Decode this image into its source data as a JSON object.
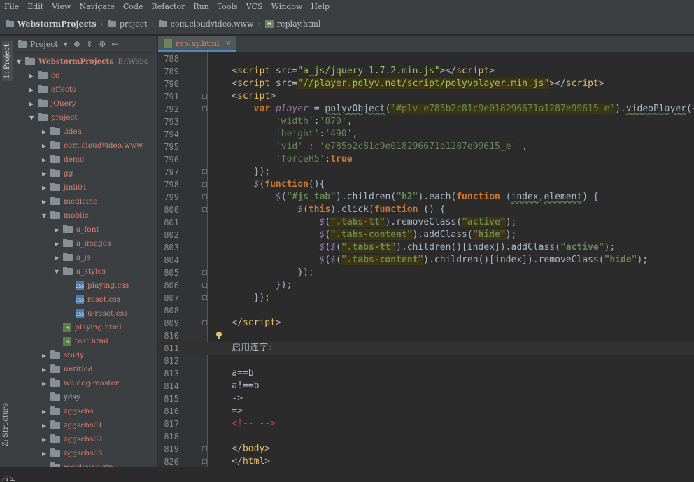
{
  "menu": [
    "File",
    "Edit",
    "View",
    "Navigate",
    "Code",
    "Refactor",
    "Run",
    "Tools",
    "VCS",
    "Window",
    "Help"
  ],
  "breadcrumb": [
    "WebstormProjects",
    "project",
    "com.cloudvideo.www",
    "replay.html"
  ],
  "side_tabs": {
    "project": "1: Project",
    "structure": "Z: Structure",
    "favorites": "2: F"
  },
  "project_panel": {
    "dropdown_label": "Project",
    "root": {
      "name": "WebstormProjects",
      "path": "E:\\Webs"
    },
    "items": [
      {
        "label": "cc",
        "type": "folder",
        "depth": 1,
        "expanded": false
      },
      {
        "label": "effects",
        "type": "folder",
        "depth": 1,
        "expanded": false
      },
      {
        "label": "jQuery",
        "type": "folder",
        "depth": 1,
        "expanded": false
      },
      {
        "label": "project",
        "type": "folder",
        "depth": 1,
        "expanded": true
      },
      {
        "label": ".idea",
        "type": "folder",
        "depth": 2,
        "expanded": false
      },
      {
        "label": "com.cloudvideo.www",
        "type": "folder",
        "depth": 2,
        "expanded": false
      },
      {
        "label": "demo",
        "type": "folder",
        "depth": 2,
        "expanded": false
      },
      {
        "label": "gg",
        "type": "folder",
        "depth": 2,
        "expanded": false
      },
      {
        "label": "jinli01",
        "type": "folder",
        "depth": 2,
        "expanded": false
      },
      {
        "label": "medicine",
        "type": "folder",
        "depth": 2,
        "expanded": false
      },
      {
        "label": "mobile",
        "type": "folder",
        "depth": 2,
        "expanded": true
      },
      {
        "label": "a_font",
        "type": "folder",
        "depth": 3,
        "expanded": false
      },
      {
        "label": "a_images",
        "type": "folder",
        "depth": 3,
        "expanded": false
      },
      {
        "label": "a_js",
        "type": "folder",
        "depth": 3,
        "expanded": false
      },
      {
        "label": "a_styles",
        "type": "folder",
        "depth": 3,
        "expanded": true
      },
      {
        "label": "playing.css",
        "type": "css",
        "depth": 4
      },
      {
        "label": "reset.css",
        "type": "css",
        "depth": 4
      },
      {
        "label": "u-reset.css",
        "type": "css",
        "depth": 4
      },
      {
        "label": "playing.html",
        "type": "html",
        "depth": 3
      },
      {
        "label": "test.html",
        "type": "html",
        "depth": 3
      },
      {
        "label": "study",
        "type": "folder",
        "depth": 2,
        "expanded": false
      },
      {
        "label": "untitled",
        "type": "folder",
        "depth": 2,
        "expanded": false
      },
      {
        "label": "we.dog-master",
        "type": "folder",
        "depth": 2,
        "expanded": false
      },
      {
        "label": "ydsy",
        "type": "folder",
        "depth": 2,
        "expanded": null
      },
      {
        "label": "zggscbs",
        "type": "folder",
        "depth": 2,
        "expanded": false
      },
      {
        "label": "zggscbs01",
        "type": "folder",
        "depth": 2,
        "expanded": false
      },
      {
        "label": "zggscbs02",
        "type": "folder",
        "depth": 2,
        "expanded": false
      },
      {
        "label": "zggscbs03",
        "type": "folder",
        "depth": 2,
        "expanded": false
      },
      {
        "label": "meidicine.zip",
        "type": "file",
        "depth": 2
      }
    ]
  },
  "editor": {
    "tab": "replay.html",
    "lines": [
      {
        "n": "788",
        "segs": []
      },
      {
        "n": "789",
        "segs": [
          [
            "a",
            "    <"
          ],
          [
            "t",
            "script "
          ],
          [
            "a",
            "src="
          ],
          [
            "s",
            "\"a_js/jquery-1.7.2.min.js\""
          ],
          [
            "a",
            ">"
          ],
          [
            "a",
            "</"
          ],
          [
            "t",
            "script"
          ],
          [
            "a",
            ">"
          ]
        ]
      },
      {
        "n": "790",
        "segs": [
          [
            "a",
            "    <"
          ],
          [
            "t",
            "script "
          ],
          [
            "a",
            "src="
          ],
          [
            "s",
            "\"//player.polyv.net/script/polyvplayer.min.js\""
          ],
          [
            "a",
            ">"
          ],
          [
            "a",
            "</"
          ],
          [
            "t",
            "script"
          ],
          [
            "a",
            ">"
          ]
        ]
      },
      {
        "n": "791",
        "segs": [
          [
            "a",
            "    <"
          ],
          [
            "t",
            "script"
          ],
          [
            "a",
            ">"
          ]
        ]
      },
      {
        "n": "792",
        "segs": [
          [
            "v",
            "        "
          ],
          [
            "k",
            "var "
          ],
          [
            "sq",
            "player"
          ],
          [
            "v",
            " = "
          ],
          [
            "u",
            "polyvObject"
          ],
          [
            "v",
            "("
          ],
          [
            "str",
            "'#plv_e785b2c81c9e018296671a1287e99615_e'"
          ],
          [
            "v",
            ")."
          ],
          [
            "u",
            "videoPlayer"
          ],
          [
            "v",
            "({"
          ]
        ]
      },
      {
        "n": "793",
        "segs": [
          [
            "v",
            "            "
          ],
          [
            "str",
            "'width'"
          ],
          [
            "v",
            ":"
          ],
          [
            "str",
            "'870'"
          ],
          [
            "v",
            ","
          ]
        ]
      },
      {
        "n": "794",
        "segs": [
          [
            "v",
            "            "
          ],
          [
            "str",
            "'height'"
          ],
          [
            "v",
            ":"
          ],
          [
            "str",
            "'490'"
          ],
          [
            "v",
            ","
          ]
        ]
      },
      {
        "n": "795",
        "segs": [
          [
            "v",
            "            "
          ],
          [
            "str",
            "'vid'"
          ],
          [
            "v",
            " : "
          ],
          [
            "str",
            "'e785b2c81c9e018296671a1287e99615_e'"
          ],
          [
            "v",
            " ,"
          ]
        ]
      },
      {
        "n": "796",
        "segs": [
          [
            "v",
            "            "
          ],
          [
            "str",
            "'forceH5'"
          ],
          [
            "v",
            ":"
          ],
          [
            "k",
            "true"
          ]
        ]
      },
      {
        "n": "797",
        "segs": [
          [
            "v",
            "        });"
          ]
        ]
      },
      {
        "n": "798",
        "segs": [
          [
            "v",
            "        "
          ],
          [
            "sq",
            "$"
          ],
          [
            "v",
            "("
          ],
          [
            "k",
            "function"
          ],
          [
            "v",
            "(){"
          ]
        ]
      },
      {
        "n": "799",
        "segs": [
          [
            "v",
            "            "
          ],
          [
            "sq",
            "$"
          ],
          [
            "v",
            "("
          ],
          [
            "sb",
            "\"#js_tab\""
          ],
          [
            "v",
            ").children("
          ],
          [
            "sb",
            "\"h2\""
          ],
          [
            "v",
            ").each("
          ],
          [
            "k",
            "function "
          ],
          [
            "v",
            "("
          ],
          [
            "u",
            "index"
          ],
          [
            "v",
            ","
          ],
          [
            "u",
            "element"
          ],
          [
            "v",
            ") {"
          ]
        ]
      },
      {
        "n": "800",
        "segs": [
          [
            "v",
            "                "
          ],
          [
            "sq",
            "$"
          ],
          [
            "v",
            "("
          ],
          [
            "k",
            "this"
          ],
          [
            "v",
            ").click("
          ],
          [
            "k",
            "function "
          ],
          [
            "v",
            "() {"
          ]
        ]
      },
      {
        "n": "801",
        "segs": [
          [
            "v",
            "                    "
          ],
          [
            "sq",
            "$"
          ],
          [
            "v",
            "("
          ],
          [
            "sb",
            "\".tabs-tt\""
          ],
          [
            "v",
            ").removeClass("
          ],
          [
            "sb",
            "\"active\""
          ],
          [
            "v",
            ");"
          ]
        ]
      },
      {
        "n": "802",
        "segs": [
          [
            "v",
            "                    "
          ],
          [
            "sq",
            "$"
          ],
          [
            "v",
            "("
          ],
          [
            "sb",
            "\".tabs-content\""
          ],
          [
            "v",
            ").addClass("
          ],
          [
            "sb",
            "\"hide\""
          ],
          [
            "v",
            ");"
          ]
        ]
      },
      {
        "n": "803",
        "segs": [
          [
            "v",
            "                    "
          ],
          [
            "sq",
            "$"
          ],
          [
            "v",
            "("
          ],
          [
            "sq",
            "$"
          ],
          [
            "v",
            "("
          ],
          [
            "sb",
            "\".tabs-tt\""
          ],
          [
            "v",
            ").children()[index]).addClass("
          ],
          [
            "sb",
            "\"active\""
          ],
          [
            "v",
            ");"
          ]
        ]
      },
      {
        "n": "804",
        "segs": [
          [
            "v",
            "                    "
          ],
          [
            "sq",
            "$"
          ],
          [
            "v",
            "("
          ],
          [
            "sq",
            "$"
          ],
          [
            "v",
            "("
          ],
          [
            "sb",
            "\".tabs-content\""
          ],
          [
            "v",
            ").children()[index]).removeClass("
          ],
          [
            "sb",
            "\"hide\""
          ],
          [
            "v",
            ");"
          ]
        ]
      },
      {
        "n": "805",
        "segs": [
          [
            "v",
            "                });"
          ]
        ]
      },
      {
        "n": "806",
        "segs": [
          [
            "v",
            "            });"
          ]
        ]
      },
      {
        "n": "807",
        "segs": [
          [
            "v",
            "        });"
          ]
        ]
      },
      {
        "n": "808",
        "segs": []
      },
      {
        "n": "809",
        "segs": [
          [
            "a",
            "    </"
          ],
          [
            "t",
            "script"
          ],
          [
            "a",
            ">"
          ]
        ]
      },
      {
        "n": "810",
        "segs": []
      },
      {
        "n": "811",
        "segs": [
          [
            "v",
            "    启用连字:"
          ]
        ]
      },
      {
        "n": "812",
        "segs": []
      },
      {
        "n": "813",
        "segs": [
          [
            "v",
            "    a==b"
          ]
        ]
      },
      {
        "n": "814",
        "segs": [
          [
            "v",
            "    a!==b"
          ]
        ]
      },
      {
        "n": "815",
        "segs": [
          [
            "v",
            "    ->"
          ]
        ]
      },
      {
        "n": "816",
        "segs": [
          [
            "v",
            "    =>"
          ]
        ]
      },
      {
        "n": "817",
        "segs": [
          [
            "red",
            "    <!-- -->"
          ]
        ]
      },
      {
        "n": "818",
        "segs": []
      },
      {
        "n": "819",
        "segs": [
          [
            "a",
            "    </"
          ],
          [
            "t",
            "body"
          ],
          [
            "a",
            ">"
          ]
        ]
      },
      {
        "n": "820",
        "segs": [
          [
            "a",
            "    </"
          ],
          [
            "t",
            "html"
          ],
          [
            "a",
            ">"
          ]
        ]
      }
    ]
  },
  "colors": {
    "bg": "#2b2b2b",
    "panel": "#3c3f41",
    "keyword": "#cc7832",
    "tag": "#e8bf6a",
    "string": "#6a8759",
    "file_label": "#d3826f"
  }
}
